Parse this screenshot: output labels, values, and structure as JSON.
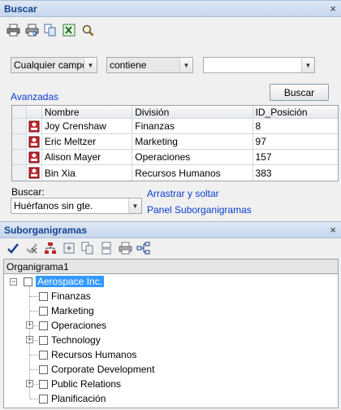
{
  "buscar_panel": {
    "title": "Buscar",
    "close_glyph": "×",
    "toolbar": [
      "print-icon",
      "print-preview-icon",
      "copy-icon",
      "excel-icon",
      "find-icon"
    ]
  },
  "search": {
    "field_value": "Cualquier campo",
    "operator_value": "contiene",
    "text_value": "",
    "advanced_link": "Avanzadas",
    "search_button": "Buscar"
  },
  "results": {
    "columns": [
      "Nombre",
      "División",
      "ID_Posición"
    ],
    "rows": [
      {
        "nombre": "Joy Crenshaw",
        "division": "Finanzas",
        "id": "8"
      },
      {
        "nombre": "Eric Meltzer",
        "division": "Marketing",
        "id": "97"
      },
      {
        "nombre": "Alison Mayer",
        "division": "Operaciones",
        "id": "157"
      },
      {
        "nombre": "Bin Xia",
        "division": "Recursos Humanos",
        "id": "383"
      }
    ]
  },
  "buscar_scope": {
    "label": "Buscar:",
    "value": "Huérfanos sin gte."
  },
  "drag_hint": {
    "line1": "Arrastrar y soltar",
    "line2": "Panel Suborganigramas"
  },
  "sub_panel": {
    "title": "Suborganigramas",
    "close_glyph": "×",
    "toolbar": [
      "check-icon",
      "uncheck-icon",
      "org-chart-icon",
      "export-icon",
      "copy-icon",
      "split-icon",
      "print-icon",
      "layout-icon"
    ]
  },
  "tree": {
    "tab_label": "Organigrama1",
    "root": "Aerospace Inc.",
    "children": [
      {
        "label": "Finanzas",
        "expandable": false
      },
      {
        "label": "Marketing",
        "expandable": false
      },
      {
        "label": "Operaciones",
        "expandable": true
      },
      {
        "label": "Technology",
        "expandable": true
      },
      {
        "label": "Recursos Humanos",
        "expandable": false
      },
      {
        "label": "Corporate Development",
        "expandable": false
      },
      {
        "label": "Public Relations",
        "expandable": true
      },
      {
        "label": "Planificación",
        "expandable": false
      }
    ]
  },
  "colors": {
    "header_title": "#15428b",
    "link": "#0a3ccf",
    "selection": "#3399ff",
    "person_icon": "#c0282d"
  }
}
